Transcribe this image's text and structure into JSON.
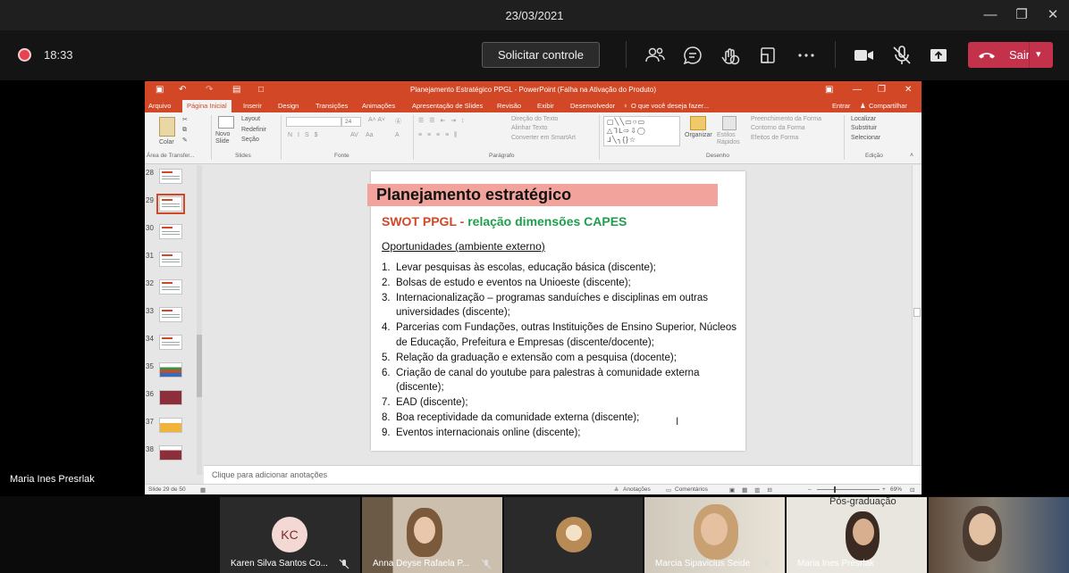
{
  "window": {
    "date": "23/03/2021",
    "min": "—",
    "restore": "❐",
    "close": "✕"
  },
  "toolbar": {
    "timer": "18:33",
    "request_control": "Solicitar controle",
    "leave": "Sair"
  },
  "presenter": "Maria Ines Presrlak",
  "ppt": {
    "title": "Planejamento Estratégico PPGL - PowerPoint (Falha na Ativação do Produto)",
    "tabs": [
      "Arquivo",
      "Página Inicial",
      "Inserir",
      "Design",
      "Transições",
      "Animações",
      "Apresentação de Slides",
      "Revisão",
      "Exibir",
      "Desenvolvedor"
    ],
    "tell_me": "O que você deseja fazer...",
    "signin": "Entrar",
    "share": "Compartilhar",
    "ribbon": {
      "paste": "Colar",
      "new_slide": "Novo Slide",
      "layout": "Layout",
      "reset": "Redefinir",
      "section": "Seção",
      "font_size": "24",
      "text_direction": "Direção do Texto",
      "align_text": "Alinhar Texto",
      "smartart": "Converter em SmartArt",
      "arrange": "Organizar",
      "quick_styles": "Estilos Rápidos",
      "shape_fill": "Preenchimento da Forma",
      "shape_outline": "Contorno da Forma",
      "shape_effects": "Efeitos de Forma",
      "find": "Localizar",
      "replace": "Substituir",
      "select": "Selecionar",
      "groups": [
        "Área de Transfer...",
        "Slides",
        "Fonte",
        "Parágrafo",
        "Desenho",
        "Edição"
      ]
    },
    "thumb_numbers": [
      "28",
      "29",
      "30",
      "31",
      "32",
      "33",
      "34",
      "35",
      "36",
      "37",
      "38"
    ],
    "notes_placeholder": "Clique para adicionar anotações",
    "status": {
      "slide_info": "Slide 29 de 50",
      "notes": "Anotações",
      "comments": "Comentários",
      "zoom": "69%"
    }
  },
  "slide": {
    "title": "Planejamento estratégico",
    "subtitle_a": "SWOT PPGL - ",
    "subtitle_b": "relação dimensões CAPES",
    "heading": "Oportunidades (ambiente externo)",
    "items": [
      {
        "n": "1.",
        "text": "Levar pesquisas às escolas, educação básica (discente);"
      },
      {
        "n": "2.",
        "text": "Bolsas de estudo e eventos na Unioeste (discente);"
      },
      {
        "n": "3.",
        "text": "Internacionalização – programas sanduíches e disciplinas em outras universidades (discente);"
      },
      {
        "n": "4.",
        "text": "Parcerias com Fundações, outras Instituições de Ensino Superior, Núcleos de Educação, Prefeitura  e Empresas (discente/docente);"
      },
      {
        "n": "5.",
        "text": "Relação da graduação e extensão com a pesquisa (docente);"
      },
      {
        "n": "6.",
        "text": "Criação de canal do youtube para palestras à comunidade externa (discente);"
      },
      {
        "n": "7.",
        "text": "EAD (discente);"
      },
      {
        "n": "8.",
        "text": "Boa receptividade da comunidade externa (discente);"
      },
      {
        "n": "9.",
        "text": "Eventos internacionais online (discente);"
      }
    ]
  },
  "participants": [
    {
      "name": "Karen Silva Santos Co...",
      "initials": "KC"
    },
    {
      "name": "Anna Deyse Rafaela P..."
    },
    {
      "name": ""
    },
    {
      "name": "Marcia Sipavicius Seide"
    },
    {
      "name": "Maria Ines Presrlak",
      "bg_text": "Pós-graduação"
    },
    {
      "name": ""
    }
  ],
  "colors": {
    "ppt_accent": "#d24726",
    "leave": "#c4314b",
    "title_band": "#f2a39b",
    "green": "#1e9e4e"
  }
}
